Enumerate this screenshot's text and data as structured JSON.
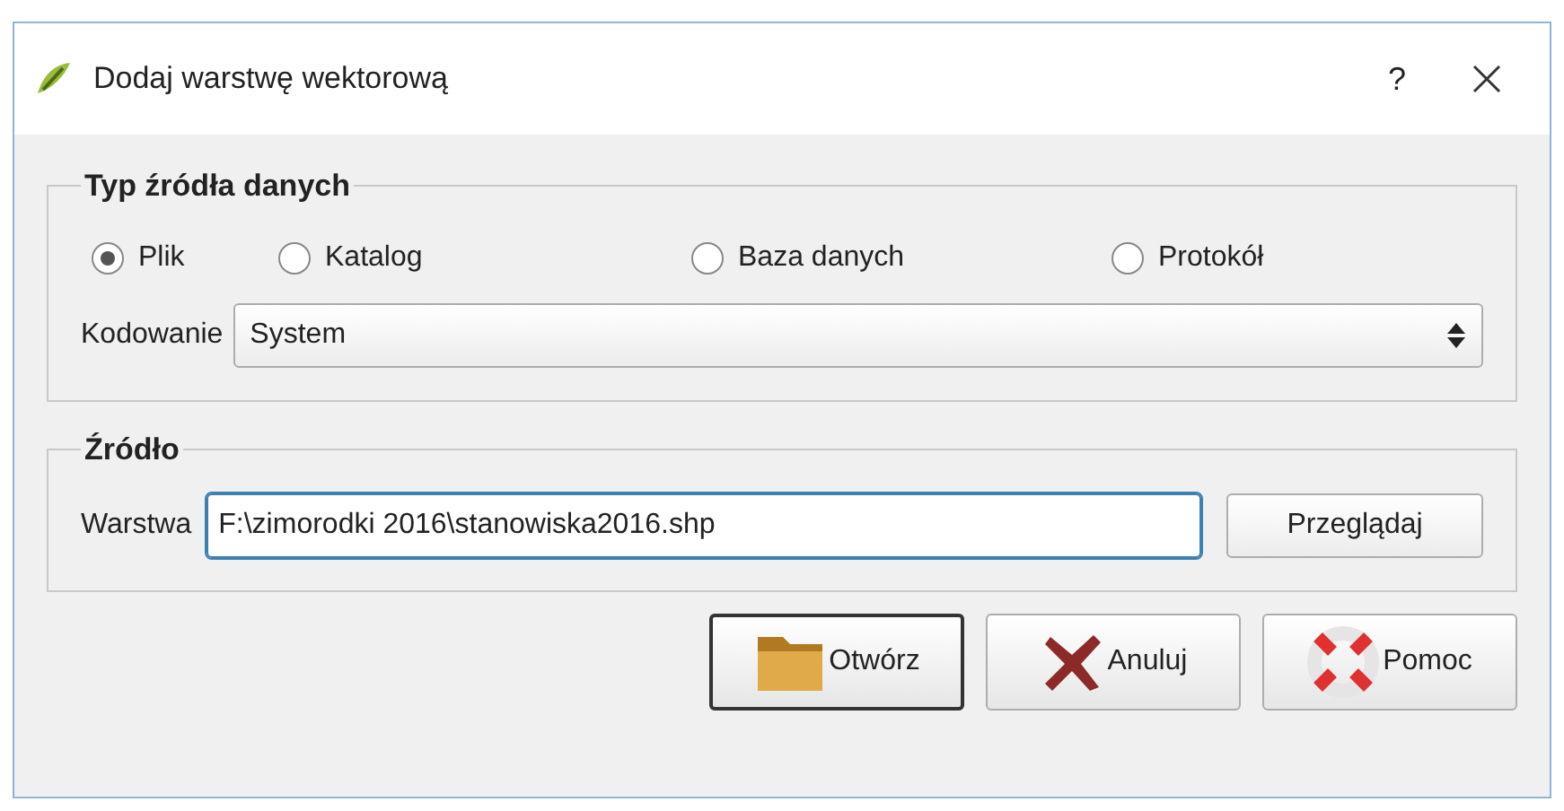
{
  "window": {
    "title": "Dodaj warstwę wektorową",
    "help": "?"
  },
  "source_type": {
    "title": "Typ źródła danych",
    "options": [
      {
        "label": "Plik",
        "selected": true
      },
      {
        "label": "Katalog",
        "selected": false
      },
      {
        "label": "Baza danych",
        "selected": false
      },
      {
        "label": "Protokół",
        "selected": false
      }
    ],
    "encoding": {
      "label": "Kodowanie",
      "value": "System"
    }
  },
  "source": {
    "title": "Źródło",
    "layer": {
      "label": "Warstwa",
      "value": "F:\\zimorodki 2016\\stanowiska2016.shp",
      "focused": true
    },
    "browse": "Przeglądaj"
  },
  "buttons": [
    {
      "label": "Otwórz",
      "kind": "open",
      "default": true
    },
    {
      "label": "Anuluj",
      "kind": "cancel",
      "default": false
    },
    {
      "label": "Pomoc",
      "kind": "help",
      "default": false
    }
  ]
}
